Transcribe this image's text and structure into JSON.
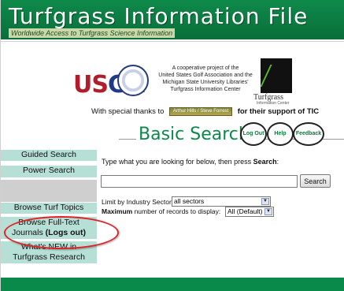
{
  "header": {
    "title": "Turfgrass Information File",
    "subtitle": "Worldwide Access to Turfgrass Science Information"
  },
  "partners": {
    "usga_text_us": "US",
    "usga_text_ga": "GA",
    "coop_line1": "A cooperative project of the",
    "coop_line2": "United States Golf Association and the",
    "coop_line3": "Michigan State University Libraries'",
    "coop_line4": "Turfgrass Information Center",
    "tic_name": "Turfgrass",
    "tic_name_small": "Information Center",
    "thanks_before": "With special thanks to",
    "thanks_sponsor": "Arthur Hills / Steve Forrest",
    "thanks_after": "for their support of TIC"
  },
  "main": {
    "title": "Basic Search",
    "logout_label": "Log Out",
    "help_label": "Help",
    "feedback_label": "Feedback",
    "prompt_before": "Type what you are looking for below, then press ",
    "prompt_bold": "Search",
    "prompt_after": ":",
    "search_value": "",
    "search_button": "Search",
    "limit_label": "Limit by Industry Sector",
    "sector_value": "all sectors",
    "max_bold": "Maximum",
    "max_rest": " number of records to display:",
    "max_value": "All (Default)"
  },
  "sidebar": {
    "items": [
      {
        "label": "Guided Search"
      },
      {
        "label": "Power Search"
      },
      {
        "label": "Browse Turf Topics"
      },
      {
        "label_line1": "Browse Full-Text",
        "label_line2a": "Journals ",
        "label_line2b": "(Logs out)"
      },
      {
        "label_line1": "What's NEW in",
        "label_line2": "Turfgrass Research"
      }
    ]
  },
  "colors": {
    "brand_green": "#0a8a4a",
    "sidebar_teal": "#b6e0d6",
    "highlight_red": "#e0242a",
    "usga_red": "#b01e2c",
    "usga_blue": "#1f3a8a"
  }
}
